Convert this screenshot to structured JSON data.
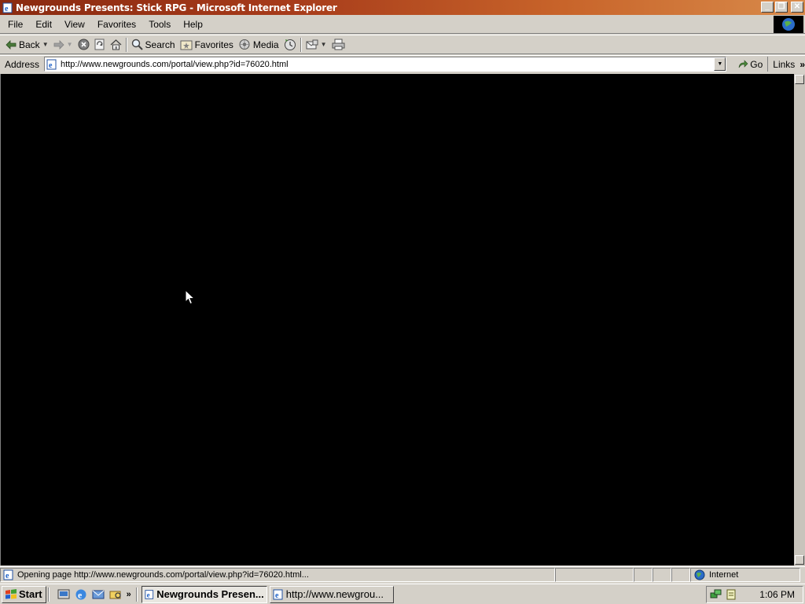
{
  "window": {
    "title": "Newgrounds Presents: Stick RPG - Microsoft Internet Explorer",
    "buttons": {
      "minimize": "_",
      "restore": "❐",
      "close": "✕"
    }
  },
  "menu": [
    "File",
    "Edit",
    "View",
    "Favorites",
    "Tools",
    "Help"
  ],
  "toolbar": {
    "back": "Back",
    "search": "Search",
    "favorites": "Favorites",
    "media": "Media"
  },
  "address": {
    "label": "Address",
    "url": "http://www.newgrounds.com/portal/view.php?id=76020.html",
    "go": "Go",
    "links": "Links",
    "links_chevron": "»"
  },
  "status": {
    "text": "Opening page http://www.newgrounds.com/portal/view.php?id=76020.html...",
    "zone": "Internet"
  },
  "taskbar": {
    "start": "Start",
    "quicklaunch_more": "»",
    "tasks": [
      {
        "label": "Newgrounds Presen...",
        "active": true
      },
      {
        "label": "http://www.newgrou...",
        "active": false
      }
    ],
    "clock": "1:06 PM"
  },
  "colors": {
    "titlebar_start": "#8a2a10",
    "titlebar_end": "#d88a4a",
    "chrome": "#d4d0c8",
    "content_bg": "#000000"
  },
  "icons": [
    "ie-page-icon",
    "back-arrow-icon",
    "forward-arrow-icon",
    "stop-icon",
    "refresh-icon",
    "home-icon",
    "search-icon",
    "favorites-icon",
    "media-icon",
    "history-icon",
    "mail-icon",
    "print-icon",
    "go-arrow-icon",
    "internet-globe-icon",
    "windows-flag-icon",
    "mouse-cursor-icon"
  ]
}
